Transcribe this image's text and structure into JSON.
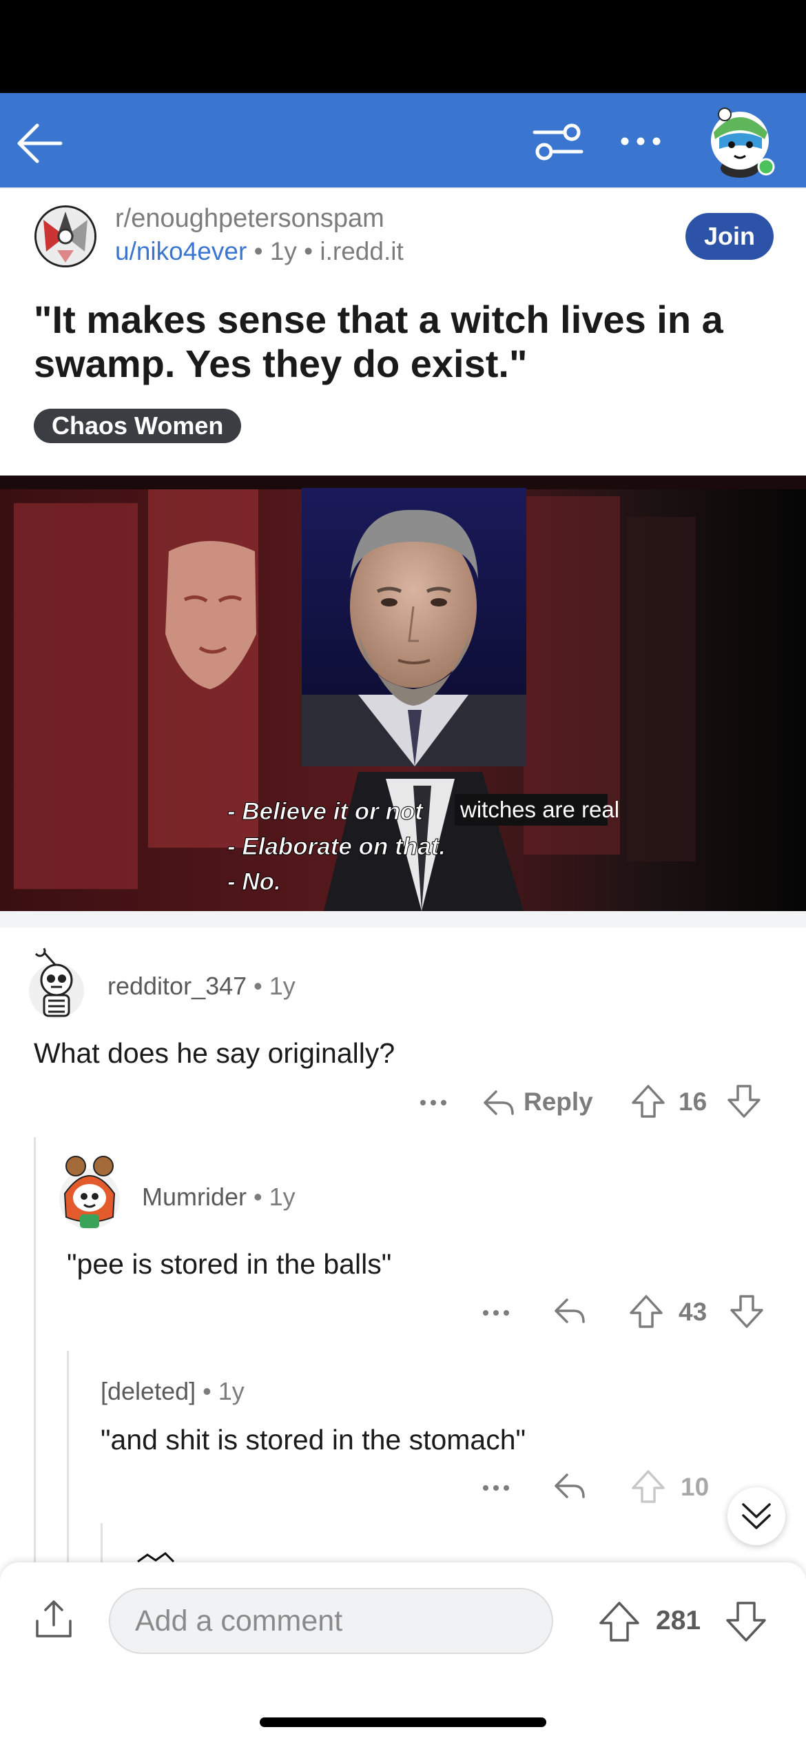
{
  "post": {
    "subreddit": "r/enoughpetersonspam",
    "author": "u/niko4ever",
    "age": "1y",
    "domain": "i.redd.it",
    "join_label": "Join",
    "title": "\"It makes sense that a witch lives in a swamp. Yes they do exist.\"",
    "flair": "Chaos Women",
    "image_captions": {
      "line1_prefix": "- Believe it or not",
      "line1_overlay": "witches are real",
      "line2": "- Elaborate on that.",
      "line3": "- No."
    }
  },
  "comments": [
    {
      "author": "redditor_347",
      "age": "1y",
      "body": "What does he say originally?",
      "reply_label": "Reply",
      "score": "16"
    },
    {
      "author": "Mumrider",
      "age": "1y",
      "body": "\"pee is stored in the balls\"",
      "score": "43"
    },
    {
      "author": "[deleted]",
      "age": "1y",
      "body": "\"and shit is stored in the stomach\"",
      "score": "10"
    }
  ],
  "bottom": {
    "comment_placeholder": "Add a comment",
    "score": "281"
  },
  "colors": {
    "navbar": "#3a76cf",
    "join": "#2d53a8",
    "username_link": "#3a76cf",
    "flair_bg": "#3a3d42"
  },
  "icons": [
    "back-arrow-icon",
    "filter-icon",
    "more-icon",
    "user-avatar",
    "upvote-icon",
    "downvote-icon",
    "reply-icon",
    "share-icon",
    "double-chevron-down-icon"
  ]
}
